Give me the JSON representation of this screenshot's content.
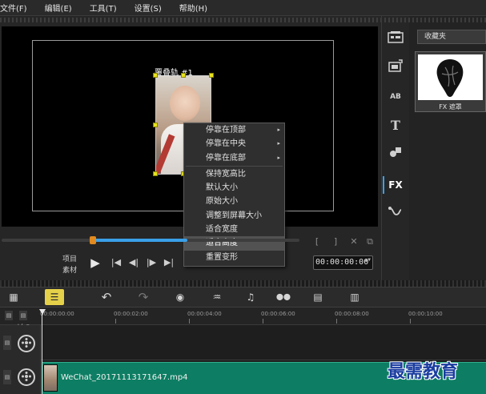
{
  "menu": {
    "items": [
      "文件(F)",
      "编辑(E)",
      "工具(T)",
      "设置(S)",
      "帮助(H)"
    ]
  },
  "preview": {
    "clip_label": "覆叠轨 #1"
  },
  "context_menu": {
    "items": [
      {
        "label": "停靠在顶部",
        "submenu": true
      },
      {
        "label": "停靠在中央",
        "submenu": true
      },
      {
        "label": "停靠在底部",
        "submenu": true
      },
      {
        "label": "保持宽高比"
      },
      {
        "label": "默认大小"
      },
      {
        "label": "原始大小"
      },
      {
        "label": "调整到屏幕大小"
      },
      {
        "label": "适合宽度"
      },
      {
        "label": "适合高度",
        "highlighted": true
      },
      {
        "label": "重置变形"
      }
    ],
    "submenu_glyph": "▸"
  },
  "transport": {
    "mode_project": "项目",
    "mode_clip": "素材",
    "timecode": "00:00:00:00",
    "play_glyph": "▶",
    "home_glyph": "|◀",
    "prev_glyph": "◀|",
    "next_glyph": "|▶",
    "end_glyph": "▶|",
    "trim_in": "[",
    "trim_out": "]",
    "cut_glyph": "✕",
    "copy_glyph": "⧉",
    "spin_glyph": "▲▼"
  },
  "sidebar": {
    "fx_label": "FX",
    "title_label": "T",
    "ab_label": "AB"
  },
  "library": {
    "dropdown_label": "收藏夹",
    "thumb_label": "FX 遮罩"
  },
  "toolbar": {
    "storyboard_glyph": "▦",
    "timeline_glyph": "☰",
    "undo_glyph": "↶",
    "redo_glyph": "↷",
    "record_glyph": "◉",
    "audio_glyph": "♒",
    "auto_music_glyph": "♫",
    "motion_glyph": "⬤⬤",
    "subtitle_glyph": "▤",
    "multi_glyph": "▥"
  },
  "timeline": {
    "ticks": [
      "00:00:00:00",
      "00:00:02:00",
      "00:00:04:00",
      "00:00:06:00",
      "00:00:08:00",
      "00:00:10:00"
    ],
    "zoom_label": "+/- ▾",
    "video_clip_name": "WeChat_20171113171647.mp4",
    "track_tab_glyph": "▤"
  },
  "watermark": "最需教育",
  "colors": {
    "accent": "#3aa0e8",
    "clip_green": "#0d7e63",
    "highlight_yellow": "#e5d04a",
    "handle_yellow": "#e7e21d",
    "watermark_blue": "#1b3da0"
  }
}
